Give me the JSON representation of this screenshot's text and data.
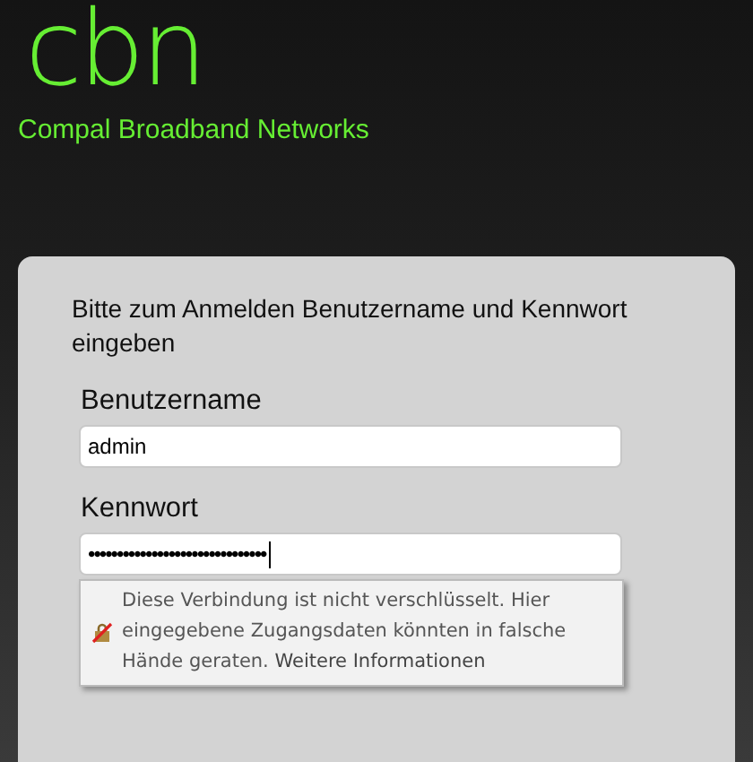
{
  "brand": {
    "logo": "cbn",
    "name": "Compal Broadband Networks"
  },
  "login": {
    "heading": "Bitte zum Anmelden Benutzername und Kennwort eingeben",
    "username": {
      "label": "Benutzername",
      "value": "admin"
    },
    "password": {
      "label": "Kennwort",
      "masked_value": "•••••••••••••••••••••••••••••••"
    },
    "warning": {
      "text": "Diese Verbindung ist nicht verschlüsselt. Hier eingegebene Zugangsdaten könnten in falsche Hände geraten.",
      "link": "Weitere Informationen"
    }
  }
}
